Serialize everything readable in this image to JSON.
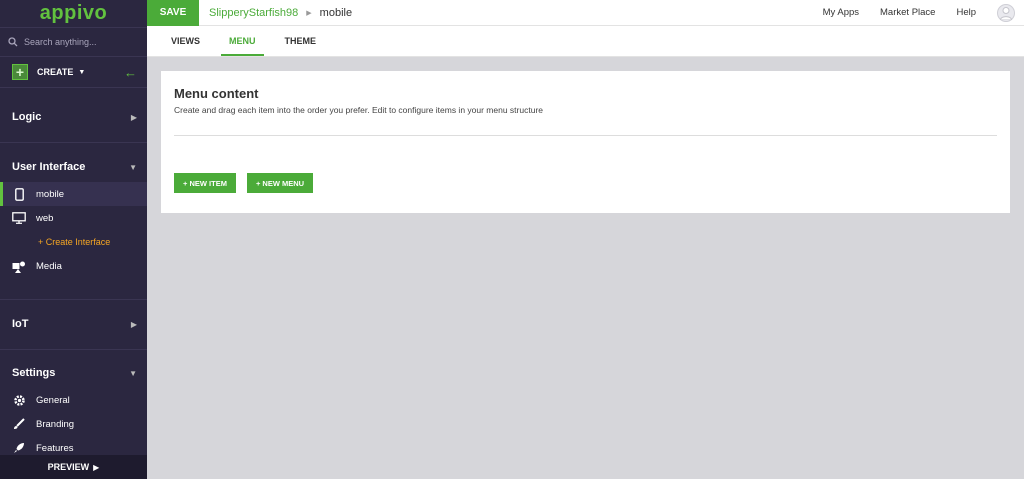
{
  "sidebar": {
    "logo": "appivo",
    "search_placeholder": "Search anything...",
    "create_label": "CREATE",
    "sections": {
      "logic": "Logic",
      "user_interface": "User Interface",
      "iot": "IoT",
      "settings": "Settings"
    },
    "ui_items": {
      "mobile": "mobile",
      "web": "web",
      "create_interface": "+ Create Interface",
      "media": "Media"
    },
    "settings_items": {
      "general": "General",
      "branding": "Branding",
      "features": "Features"
    },
    "preview_label": "PREVIEW"
  },
  "topbar": {
    "save_label": "SAVE",
    "app_name": "SlipperyStarfish98",
    "page_name": "mobile",
    "links": {
      "my_apps": "My Apps",
      "market_place": "Market Place",
      "help": "Help"
    }
  },
  "tabs": {
    "views": "VIEWS",
    "menu": "MENU",
    "theme": "THEME",
    "active": "MENU"
  },
  "card": {
    "title": "Menu content",
    "description": "Create and drag each item into the order you prefer. Edit to configure items in your menu structure",
    "new_item_label": "+ NEW ITEM",
    "new_menu_label": "+ NEW MENU"
  },
  "colors": {
    "accent_green": "#4bab39",
    "sidebar_bg": "#2b2740",
    "create_interface_orange": "#f5a623",
    "content_bg": "#d6d6da"
  }
}
